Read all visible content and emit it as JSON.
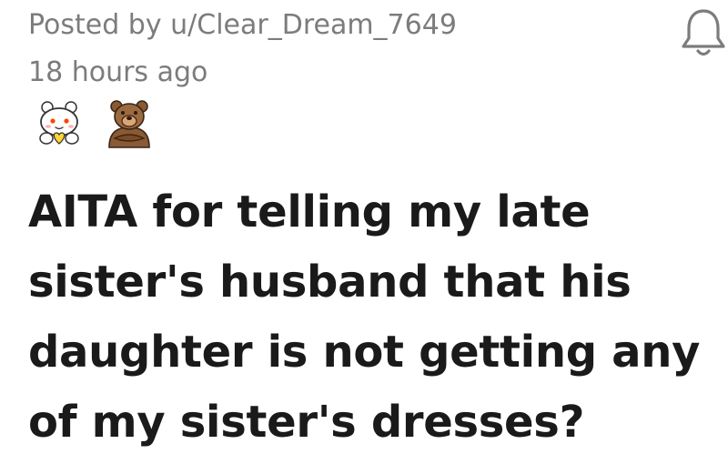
{
  "post": {
    "posted_by": "Posted by u/Clear_Dream_7649",
    "time_ago": "18 hours ago",
    "title_lines": [
      "AITA for telling my late",
      "sister's husband that his",
      "daughter is not getting any",
      "of my sister's dresses?"
    ]
  },
  "icons": {
    "notification": "bell-icon",
    "awards": [
      "wholesome-award-icon",
      "bear-award-icon"
    ]
  },
  "colors": {
    "meta_text": "#7c7c7c",
    "title_text": "#1a1a1b",
    "background": "#ffffff"
  }
}
